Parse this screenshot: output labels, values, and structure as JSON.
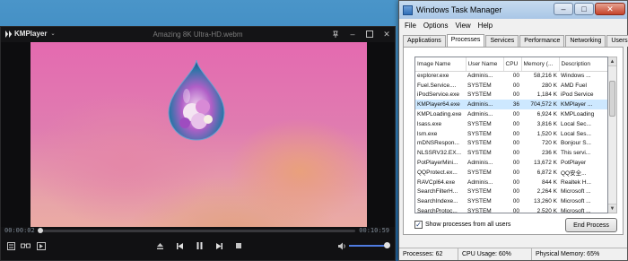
{
  "kmplayer": {
    "app_name": "KMPlayer",
    "filename": "Amazing 8K Ultra-HD.webm",
    "time_current": "00:00:02",
    "time_total": "00:10:59",
    "progress_fraction": 0.003,
    "volume_fraction": 0.95
  },
  "taskmanager": {
    "title": "Windows Task Manager",
    "menu": [
      "File",
      "Options",
      "View",
      "Help"
    ],
    "tabs": [
      "Applications",
      "Processes",
      "Services",
      "Performance",
      "Networking",
      "Users"
    ],
    "active_tab": "Processes",
    "columns": [
      "Image Name",
      "User Name",
      "CPU",
      "Memory (...",
      "Description"
    ],
    "rows": [
      [
        "explorer.exe",
        "Adminis...",
        "00",
        "58,216 K",
        "Windows ..."
      ],
      [
        "Fuel.Service....",
        "SYSTEM",
        "00",
        "280 K",
        "AMD Fuel"
      ],
      [
        "iPodService.exe",
        "SYSTEM",
        "00",
        "1,184 K",
        "iPod Service"
      ],
      [
        "KMPlayer64.exe",
        "Adminis...",
        "36",
        "704,572 K",
        "KMPlayer ..."
      ],
      [
        "KMPLoading.exe",
        "Adminis...",
        "00",
        "6,924 K",
        "KMPLoading"
      ],
      [
        "lsass.exe",
        "SYSTEM",
        "00",
        "3,816 K",
        "Local Sec..."
      ],
      [
        "lsm.exe",
        "SYSTEM",
        "00",
        "1,520 K",
        "Local Ses..."
      ],
      [
        "mDNSRespon...",
        "SYSTEM",
        "00",
        "720 K",
        "Bonjour S..."
      ],
      [
        "NLSSRV32.EX...",
        "SYSTEM",
        "00",
        "236 K",
        "This servi..."
      ],
      [
        "PotPlayerMini...",
        "Adminis...",
        "00",
        "13,672 K",
        "PotPlayer"
      ],
      [
        "QQProtect.ex...",
        "SYSTEM",
        "00",
        "6,872 K",
        "QQ安全..."
      ],
      [
        "RAVCpl64.exe",
        "Adminis...",
        "00",
        "844 K",
        "Realtek H..."
      ],
      [
        "SearchFilterH...",
        "SYSTEM",
        "00",
        "2,264 K",
        "Microsoft ..."
      ],
      [
        "SearchIndexe...",
        "SYSTEM",
        "00",
        "13,260 K",
        "Microsoft ..."
      ],
      [
        "SearchProtoc...",
        "SYSTEM",
        "00",
        "2,520 K",
        "Microsoft ..."
      ]
    ],
    "selected_row": 3,
    "show_all_label": "Show processes from all users",
    "end_process_label": "End Process",
    "status": {
      "processes": "Processes: 62",
      "cpu": "CPU Usage: 60%",
      "memory": "Physical Memory: 65%"
    }
  }
}
